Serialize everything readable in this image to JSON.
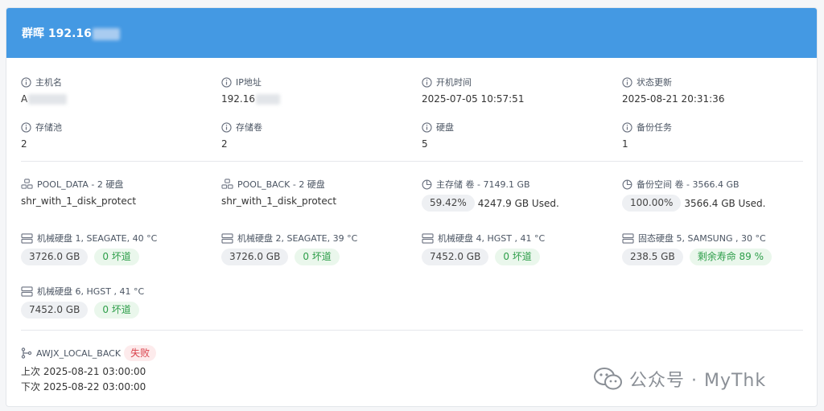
{
  "header": {
    "title": "群晖 192.16"
  },
  "info": [
    {
      "label": "主机名",
      "value": "A",
      "icon": "info-icon"
    },
    {
      "label": "IP地址",
      "value": "192.16",
      "icon": "info-icon"
    },
    {
      "label": "开机时间",
      "value": "2025-07-05 10:57:51",
      "icon": "info-icon"
    },
    {
      "label": "状态更新",
      "value": "2025-08-21 20:31:36",
      "icon": "info-icon"
    },
    {
      "label": "存储池",
      "value": "2",
      "icon": "info-icon"
    },
    {
      "label": "存储卷",
      "value": "2",
      "icon": "info-icon"
    },
    {
      "label": "硬盘",
      "value": "5",
      "icon": "info-icon"
    },
    {
      "label": "备份任务",
      "value": "1",
      "icon": "info-icon"
    }
  ],
  "pools": [
    {
      "label": "POOL_DATA - 2 硬盘",
      "value": "shr_with_1_disk_protect",
      "icon": "pool-icon"
    },
    {
      "label": "POOL_BACK - 2 硬盘",
      "value": "shr_with_1_disk_protect",
      "icon": "pool-icon"
    }
  ],
  "volumes": [
    {
      "label": "主存储 卷 - 7149.1 GB",
      "percent": "59.42%",
      "used": "4247.9 GB Used.",
      "icon": "pie-chart-icon"
    },
    {
      "label": "备份空间 卷 - 3566.4 GB",
      "percent": "100.00%",
      "used": "3566.4 GB Used.",
      "icon": "pie-chart-icon"
    }
  ],
  "disks": [
    {
      "label": "机械硬盘 1, SEAGATE, 40 °C",
      "size": "3726.0 GB",
      "status": "0 坏道",
      "icon": "hard-drive-icon"
    },
    {
      "label": "机械硬盘 2, SEAGATE, 39 °C",
      "size": "3726.0 GB",
      "status": "0 坏道",
      "icon": "hard-drive-icon"
    },
    {
      "label": "机械硬盘 4, HGST , 41 °C",
      "size": "7452.0 GB",
      "status": "0 坏道",
      "icon": "hard-drive-icon"
    },
    {
      "label": "固态硬盘 5, SAMSUNG , 30 °C",
      "size": "238.5 GB",
      "status": "剩余寿命 89 %",
      "icon": "hard-drive-icon"
    },
    {
      "label": "机械硬盘 6, HGST , 41 °C",
      "size": "7452.0 GB",
      "status": "0 坏道",
      "icon": "hard-drive-icon"
    }
  ],
  "backup": {
    "name": "AWJX_LOCAL_BACK",
    "status": "失败",
    "last": "上次 2025-08-21 03:00:00",
    "next": "下次 2025-08-22 03:00:00",
    "icon": "branch-icon"
  },
  "watermark": {
    "text": "公众号 · MyThk",
    "icon": "wechat-icon"
  },
  "colors": {
    "header": "#4499e3",
    "success": "#2e9e4a",
    "danger": "#d9414b"
  }
}
